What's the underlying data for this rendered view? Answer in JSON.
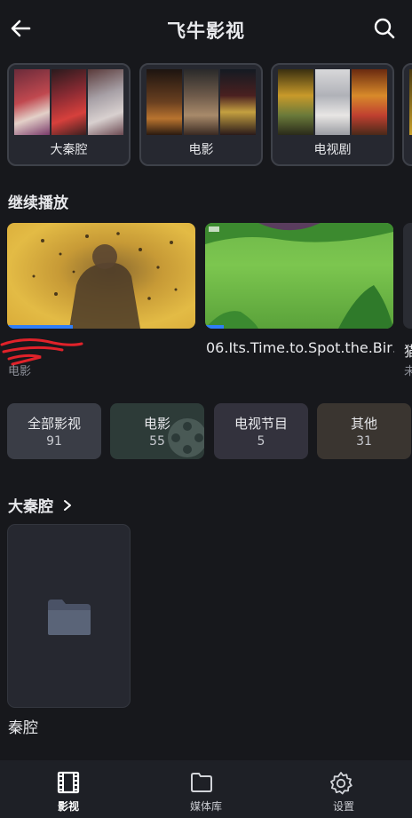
{
  "header": {
    "title": "飞牛影视"
  },
  "libraries": [
    {
      "label": "大秦腔"
    },
    {
      "label": "电影"
    },
    {
      "label": "电视剧"
    }
  ],
  "continue": {
    "title": "继续播放",
    "items": [
      {
        "title": "",
        "subtitle": "电影",
        "progress": 0.35
      },
      {
        "title": "06.Its.Time.to.Spot.the.Bir…",
        "subtitle": "",
        "progress": 0.1
      },
      {
        "title": "猫",
        "subtitle": "未"
      }
    ]
  },
  "categories": [
    {
      "label": "全部影视",
      "count": "91"
    },
    {
      "label": "电影",
      "count": "55"
    },
    {
      "label": "电视节目",
      "count": "5"
    },
    {
      "label": "其他",
      "count": "31"
    }
  ],
  "section": {
    "title": "大秦腔",
    "folder_name": "秦腔"
  },
  "nav": [
    {
      "label": "影视",
      "active": true
    },
    {
      "label": "媒体库"
    },
    {
      "label": "设置"
    }
  ],
  "colors": {
    "accent": "#2f7ef6",
    "background": "#17181c",
    "card": "#262830"
  }
}
